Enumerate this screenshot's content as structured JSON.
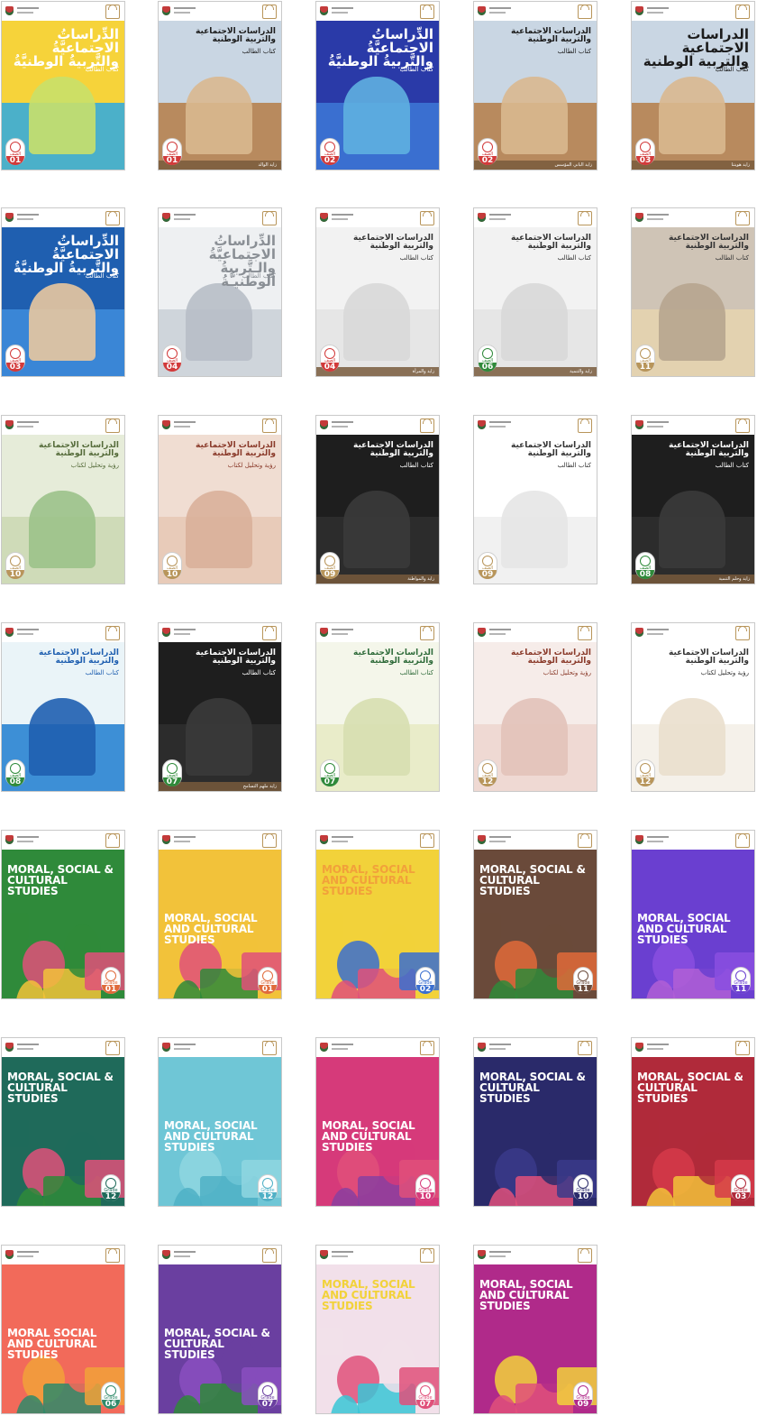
{
  "page": {
    "title": ""
  },
  "header": {
    "emblem_icon": "uae-emblem-icon",
    "ministry_icon": "ministry-logo-icon"
  },
  "books": [
    {
      "title": "الدِّراساتُ الاجتماعيَّةُ والتَّربيةُ الوطنيَّةُ",
      "subtitle": "كتاب الطالب",
      "grade_label": "الصف",
      "grade": "01",
      "lang": "ar",
      "palette": [
        "#f6d33a",
        "#4bb0c9",
        "#c9e06a"
      ],
      "accent": "#d23a3a",
      "title_color": "#ffffff"
    },
    {
      "title": "الدراسات الاجتماعية والتربية الوطنية",
      "subtitle": "كتاب الطالب",
      "grade_label": "الصف",
      "grade": "01",
      "lang": "ar",
      "palette": [
        "#c9d6e3",
        "#b88a5e",
        "#d9b88f"
      ],
      "accent": "#d23a3a",
      "title_color": "#1b1b1b",
      "caption": "زايد الوالد"
    },
    {
      "title": "الدِّراساتُ الاجتماعيَّةُ والتَّربيةُ الوطنيَّةُ",
      "subtitle": "كتاب الطالب",
      "grade_label": "الصف",
      "grade": "02",
      "lang": "ar",
      "palette": [
        "#2a3aa8",
        "#3a6fd0",
        "#5fb0e0"
      ],
      "accent": "#d23a3a",
      "title_color": "#ffffff"
    },
    {
      "title": "الدراسات الاجتماعية والتربية الوطنية",
      "subtitle": "كتاب الطالب",
      "grade_label": "الصف",
      "grade": "02",
      "lang": "ar",
      "palette": [
        "#c9d6e3",
        "#b88a5e",
        "#d9b88f"
      ],
      "accent": "#d23a3a",
      "title_color": "#1b1b1b",
      "caption": "زايد الباني المؤسس"
    },
    {
      "title": "الدراسات الاجتماعية والتربية الوطنية",
      "subtitle": "كتاب الطالب",
      "grade_label": "الصف",
      "grade": "03",
      "lang": "ar",
      "palette": [
        "#c9d6e3",
        "#b88a5e",
        "#d9b88f"
      ],
      "accent": "#d23a3a",
      "title_color": "#1b1b1b",
      "caption": "زايد هويتنا"
    },
    {
      "title": "الدِّراساتُ الاجتماعيَّةُ والتَّربيةُ الوطنيَّةُ",
      "subtitle": "كتاب الطالب",
      "grade_label": "الصف",
      "grade": "03",
      "lang": "ar",
      "palette": [
        "#1f5fb0",
        "#3a86d6",
        "#e9c8a0"
      ],
      "accent": "#d23a3a",
      "title_color": "#ffffff"
    },
    {
      "title": "الدِّراساتُ الاجتماعيَّةُ والـتَّربيةُ الوطنيـَّةُ",
      "subtitle": "كتاب الطالب",
      "grade_label": "الصف",
      "grade": "04",
      "lang": "ar",
      "palette": [
        "#eef0f2",
        "#cfd5db",
        "#b7bec6"
      ],
      "accent": "#d23a3a",
      "title_color": "#8a8f95"
    },
    {
      "title": "الدراسات الاجتماعية والتربية الوطنية",
      "subtitle": "كتاب الطالب",
      "grade_label": "الصف",
      "grade": "04",
      "lang": "ar",
      "palette": [
        "#f2f2f2",
        "#e6e6e6",
        "#d8d8d8"
      ],
      "accent": "#d23a3a",
      "title_color": "#333333",
      "caption": "زايد والمرأة"
    },
    {
      "title": "الدراسات الاجتماعية والتربية الوطنية",
      "subtitle": "كتاب الطالب",
      "grade_label": "الصف",
      "grade": "06",
      "lang": "ar",
      "palette": [
        "#f2f2f2",
        "#e6e6e6",
        "#d8d8d8"
      ],
      "accent": "#2f8a3a",
      "title_color": "#333333",
      "caption": "زايد والتنمية"
    },
    {
      "title": "الدراسات الاجتماعية والتربية الوطنية",
      "subtitle": "كتاب الطالب",
      "grade_label": "الصف",
      "grade": "11",
      "lang": "ar",
      "palette": [
        "#cfc4b6",
        "#e3d2b0",
        "#b6a58f"
      ],
      "accent": "#b8955a",
      "title_color": "#333333"
    },
    {
      "title": "الدراسات الاجتماعية والتربية الوطنية",
      "subtitle": "رؤية وتحليل لكتاب",
      "grade_label": "الصف",
      "grade": "10",
      "lang": "ar",
      "palette": [
        "#e6ecd9",
        "#cfdbb8",
        "#9bc28a"
      ],
      "accent": "#b8955a",
      "title_color": "#556b3a"
    },
    {
      "title": "الدراسات الاجتماعية والتربية الوطنية",
      "subtitle": "رؤية وتحليل لكتاب",
      "grade_label": "الصف",
      "grade": "10",
      "lang": "ar",
      "palette": [
        "#f0ddd2",
        "#e8cbb9",
        "#d9b09a"
      ],
      "accent": "#b8955a",
      "title_color": "#8a3a2a"
    },
    {
      "title": "الدراسات الاجتماعية والتربية الوطنية",
      "subtitle": "كتاب الطالب",
      "grade_label": "الصف",
      "grade": "09",
      "lang": "ar",
      "palette": [
        "#1e1e1e",
        "#2c2c2c",
        "#3a3a3a"
      ],
      "accent": "#b8955a",
      "title_color": "#ffffff",
      "caption": "زايد والمواطنة"
    },
    {
      "title": "الدراسات الاجتماعية والتربية الوطنية",
      "subtitle": "كتاب الطالب",
      "grade_label": "الصف",
      "grade": "09",
      "lang": "ar",
      "palette": [
        "#ffffff",
        "#f1f1f1",
        "#e6e6e6"
      ],
      "accent": "#b8955a",
      "title_color": "#333333"
    },
    {
      "title": "الدراسات الاجتماعية والتربية الوطنية",
      "subtitle": "كتاب الطالب",
      "grade_label": "الصف",
      "grade": "08",
      "lang": "ar",
      "palette": [
        "#1e1e1e",
        "#2c2c2c",
        "#3a3a3a"
      ],
      "accent": "#2f8a3a",
      "title_color": "#ffffff",
      "caption": "زايد وحلم التنمية"
    },
    {
      "title": "الدراسات الاجتماعية والتربية الوطنية",
      "subtitle": "كتاب الطالب",
      "grade_label": "الصف",
      "grade": "08",
      "lang": "ar",
      "palette": [
        "#eaf4f8",
        "#3d8fd6",
        "#1f5fb0"
      ],
      "accent": "#2f8a3a",
      "title_color": "#1f5fb0"
    },
    {
      "title": "الدراسات الاجتماعية والتربية الوطنية",
      "subtitle": "كتاب الطالب",
      "grade_label": "الصف",
      "grade": "07",
      "lang": "ar",
      "palette": [
        "#1e1e1e",
        "#2c2c2c",
        "#3a3a3a"
      ],
      "accent": "#2f8a3a",
      "title_color": "#ffffff",
      "caption": "زايد ملهم التسامح"
    },
    {
      "title": "الدراسات الاجتماعية والتربية الوطنية",
      "subtitle": "كتاب الطالب",
      "grade_label": "الصف",
      "grade": "07",
      "lang": "ar",
      "palette": [
        "#f4f6ea",
        "#e9ecc9",
        "#d7dfb0"
      ],
      "accent": "#2f8a3a",
      "title_color": "#2f6b3a"
    },
    {
      "title": "الدراسات الاجتماعية والتربية الوطنية",
      "subtitle": "رؤية وتحليل لكتاب",
      "grade_label": "الصف",
      "grade": "12",
      "lang": "ar",
      "palette": [
        "#f6ece9",
        "#efd9d3",
        "#e2c2b9"
      ],
      "accent": "#b8955a",
      "title_color": "#8a3a2a"
    },
    {
      "title": "الدراسات الاجتماعية والتربية الوطنية",
      "subtitle": "رؤية وتحليل لكتاب",
      "grade_label": "الصف",
      "grade": "12",
      "lang": "ar",
      "palette": [
        "#ffffff",
        "#f5f1ea",
        "#eadfcd"
      ],
      "accent": "#b8955a",
      "title_color": "#333333"
    },
    {
      "title": "Moral, Social & Cultural Studies",
      "grade_label": "Grade",
      "grade": "01",
      "lang": "en",
      "palette": [
        "#2f8a3a",
        "#e0507a",
        "#f2c23a"
      ],
      "accent": "#e06a3a",
      "title_color": "#ffffff"
    },
    {
      "title": "Moral, Social and Cultural Studies",
      "grade_label": "Grade",
      "grade": "01",
      "lang": "en",
      "palette": [
        "#f2c23a",
        "#e0507a",
        "#2f8a3a"
      ],
      "accent": "#e06a3a",
      "title_color": "#ffffff"
    },
    {
      "title": "Moral, Social and Cultural Studies",
      "grade_label": "Grade",
      "grade": "02",
      "lang": "en",
      "palette": [
        "#f2d23a",
        "#3a6fd0",
        "#e0507a"
      ],
      "accent": "#3a6fd0",
      "title_color": "#f2a13a"
    },
    {
      "title": "Moral, Social & Cultural Studies",
      "grade_label": "Grade",
      "grade": "11",
      "lang": "en",
      "palette": [
        "#6a4a3a",
        "#e06a3a",
        "#2f8a3a"
      ],
      "accent": "#6a4a3a",
      "title_color": "#ffffff"
    },
    {
      "title": "Moral, Social and Cultural Studies",
      "grade_label": "Grade",
      "grade": "11",
      "lang": "en",
      "palette": [
        "#6a3fd0",
        "#8a4fe0",
        "#b05fd6"
      ],
      "accent": "#6a3fd0",
      "title_color": "#ffffff"
    },
    {
      "title": "Moral, Social & Cultural Studies",
      "grade_label": "Grade",
      "grade": "12",
      "lang": "en",
      "palette": [
        "#1f6a5a",
        "#e0507a",
        "#2f8a3a"
      ],
      "accent": "#1f6a5a",
      "title_color": "#ffffff"
    },
    {
      "title": "Moral, Social and Cultural Studies",
      "grade_label": "Grade",
      "grade": "12",
      "lang": "en",
      "palette": [
        "#6fc6d6",
        "#8fd6e0",
        "#4fb0c6"
      ],
      "accent": "#4fb0c6",
      "title_color": "#ffffff"
    },
    {
      "title": "Moral, Social and Cultural Studies",
      "grade_label": "Grade",
      "grade": "10",
      "lang": "en",
      "palette": [
        "#d63a7a",
        "#e0507a",
        "#8a3fa0"
      ],
      "accent": "#d63a7a",
      "title_color": "#ffffff"
    },
    {
      "title": "Moral, Social & Cultural Studies",
      "grade_label": "Grade",
      "grade": "10",
      "lang": "en",
      "palette": [
        "#2a2a6a",
        "#3a3a8a",
        "#e0507a"
      ],
      "accent": "#2a2a6a",
      "title_color": "#ffffff"
    },
    {
      "title": "Moral, Social & Cultural Studies",
      "grade_label": "Grade",
      "grade": "03",
      "lang": "en",
      "palette": [
        "#b02a3a",
        "#d63a4a",
        "#f2c23a"
      ],
      "accent": "#b02a3a",
      "title_color": "#ffffff"
    },
    {
      "title": "Moral Social and Cultural Studies",
      "grade_label": "Grade",
      "grade": "06",
      "lang": "en",
      "palette": [
        "#f26a5a",
        "#f2a13a",
        "#2f8a6a"
      ],
      "accent": "#2f8a6a",
      "title_color": "#ffffff"
    },
    {
      "title": "Moral, Social & Cultural Studies",
      "grade_label": "Grade",
      "grade": "07",
      "lang": "en",
      "palette": [
        "#6a3fa0",
        "#8a4fc0",
        "#2f8a3a"
      ],
      "accent": "#6a3fa0",
      "title_color": "#ffffff"
    },
    {
      "title": "Moral, Social and Cultural Studies",
      "grade_label": "Grade",
      "grade": "07",
      "lang": "en",
      "palette": [
        "#f2e0ea",
        "#e0507a",
        "#3ac6d6"
      ],
      "accent": "#e0507a",
      "title_color": "#f2d23a"
    },
    {
      "title": "Moral, Social and Cultural Studies",
      "grade_label": "Grade",
      "grade": "09",
      "lang": "en",
      "palette": [
        "#b02a8a",
        "#f2d23a",
        "#e0507a"
      ],
      "accent": "#b02a8a",
      "title_color": "#ffffff"
    }
  ]
}
